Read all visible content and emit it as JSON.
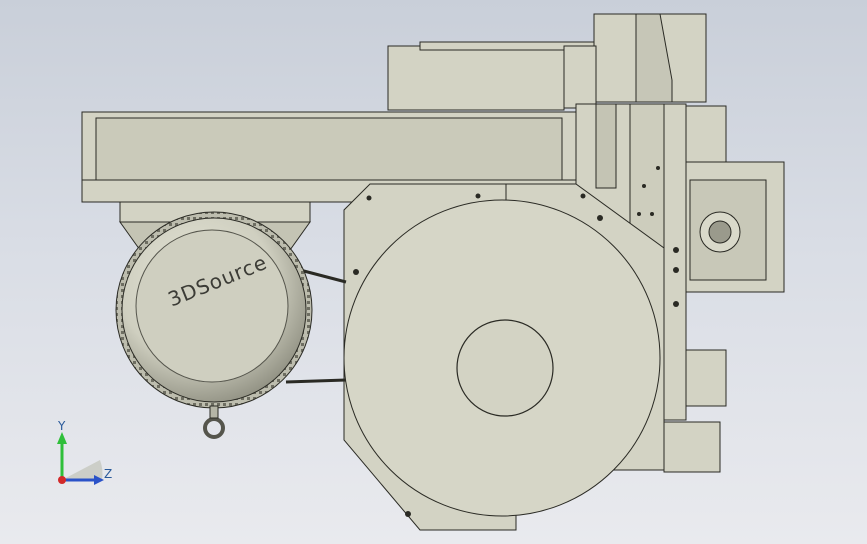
{
  "model": {
    "logo_text": "3DSource"
  },
  "triad": {
    "y_label": "Y",
    "z_label": "Z",
    "colors": {
      "y": "#2fbf3a",
      "z": "#2a52c8",
      "x": "#d22a2a"
    }
  },
  "palette": {
    "part_fill": "#d3d3c4",
    "part_fill_dark": "#b9b9a9",
    "edge": "#2a2a24",
    "background_top": "#c9cfd9",
    "background_bottom": "#e9eaee"
  }
}
